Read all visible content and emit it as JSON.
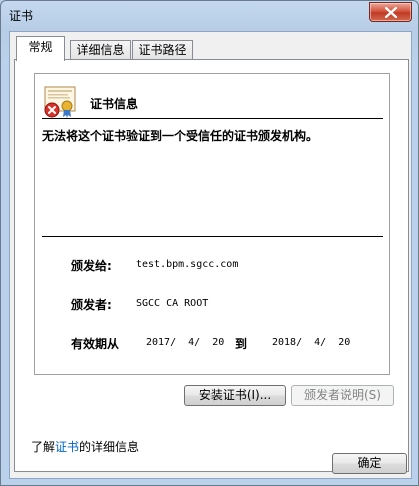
{
  "window": {
    "title": "证书"
  },
  "tabs": [
    {
      "label": "常规",
      "active": true
    },
    {
      "label": "详细信息",
      "active": false
    },
    {
      "label": "证书路径",
      "active": false
    }
  ],
  "cert": {
    "heading": "证书信息",
    "warning": "无法将这个证书验证到一个受信任的证书颁发机构。",
    "issued_to_label": "颁发给:",
    "issued_to_value": "test.bpm.sgcc.com",
    "issued_by_label": "颁发者:",
    "issued_by_value": "SGCC CA ROOT",
    "validity_label": "有效期从",
    "valid_from": "2017/  4/  20",
    "to_label": "到",
    "valid_to": "2018/  4/  20"
  },
  "buttons": {
    "install": "安装证书(I)...",
    "issuer_statement": "颁发者说明(S)",
    "ok": "确定"
  },
  "learn_more": {
    "prefix": "了解",
    "link": "证书",
    "suffix": "的详细信息"
  },
  "icons": {
    "title_close": "close-icon",
    "certificate": "certificate-error-icon"
  }
}
